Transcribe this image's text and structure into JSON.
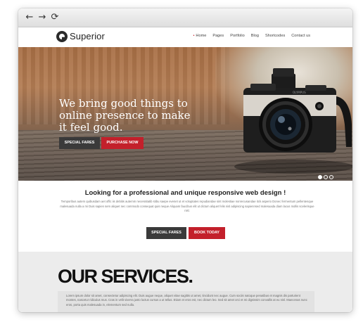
{
  "browser": {
    "back_icon": "←",
    "forward_icon": "→",
    "reload_icon": "⟳"
  },
  "site": {
    "logo": "Superior",
    "nav": [
      "Home",
      "Pages",
      "Portfolio",
      "Blog",
      "Shortcodes",
      "Contact us"
    ]
  },
  "hero": {
    "title": "We bring good things to online presence to make it feel good.",
    "button_primary": "SPECIAL FARES",
    "button_secondary": "PURCHASE NOW",
    "slider_active": 1,
    "slider_count": 3
  },
  "intro": {
    "heading": "Looking for a professional and unique responsive web design !",
    "text": "Temporibus autem quibusdam aet offic iis debitis autemm necessitatib stibu saepe evenet ut et voluptates repudiandae sint molestiae nonrecusandae itck asperio Donec fermentum pellentesque malesuada nulla a mi Duis sapien sem aliquet nec commodo consequat quis neque Aliquam faucibus elit ut dictum aliquet felis nisl adipiscing sapiennsed malesuada diam lacus mollis scelerisque nisl.",
    "button_primary": "SPECIAL FARES",
    "button_secondary": "BOOK TODAY"
  },
  "services": {
    "heading": "OUR SERVICES.",
    "text": "Lorem ipsum dolor sit amet, consectetur adipiscing elit. Duis augue neque, aliquet vitae sagittis ut amet, tincidunt nec augue. Cum sociis natoque penatibus et magnis dis parturient montes, nascetur ridiculus mus. Cras in velit viverra justo luctus cursus a ut tellus. Etiam et eros est, nec dictum leo. Sed sit amet orci et mi dignissim convallis at eu nisl. Maecenas nunc eros, porta quis malesuada in, elementum sed nulla."
  },
  "colors": {
    "accent": "#c3202b",
    "dark_button": "#3a3a3a"
  }
}
